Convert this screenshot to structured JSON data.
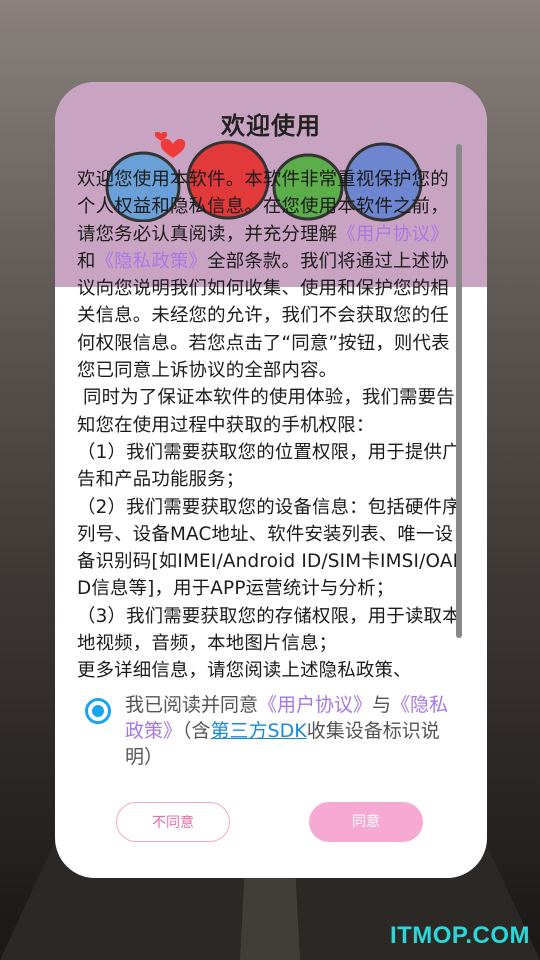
{
  "dialog": {
    "title": "欢迎使用",
    "body": {
      "p1_a": "欢迎您使用本软件。本软件非常重视保护您的个人权益和隐私信息。在您使用本软件之前，请您务必认真阅读，并充分理解",
      "p1_link1": "《用户协议》",
      "p1_and": "和",
      "p1_link2": "《隐私政策》",
      "p1_b": "全部条款。我们将通过上述协议向您说明我们如何收集、使用和保护您的相关信息。未经您的允许，我们不会获取您的任何权限信息。若您点击了“同意”按钮，则代表您已同意上诉协议的全部内容。",
      "p2": " 同时为了保证本软件的使用体验，我们需要告知您在使用过程中获取的手机权限：",
      "p3": "（1）我们需要获取您的位置权限，用于提供广告和产品功能服务；",
      "p4": "（2）我们需要获取您的设备信息：包括硬件序列号、设备MAC地址、软件安装列表、唯一设备识别码[如IMEI/Android ID/SIM卡IMSI/OAID信息等]，用于APP运营统计与分析；",
      "p5": "（3）我们需要获取您的存储权限，用于读取本地视频，音频，本地图片信息；",
      "p6": "更多详细信息，请您阅读上述隐私政策、"
    },
    "consent": {
      "prefix": "我已阅读并同意",
      "link_user": "《用户协议》",
      "and": "与",
      "link_privacy": "《隐私政策》",
      "paren_open": "（含",
      "link_sdk": "第三方SDK",
      "suffix": "收集设备标识说明）"
    },
    "buttons": {
      "disagree": "不同意",
      "agree": "同意"
    }
  },
  "watermark": "ITMOP.COM",
  "colors": {
    "header_band": "#c9a4c2",
    "link_purple": "#a678e6",
    "radio_blue": "#1aa3ee",
    "agree_pink": "#f6a9d2"
  }
}
